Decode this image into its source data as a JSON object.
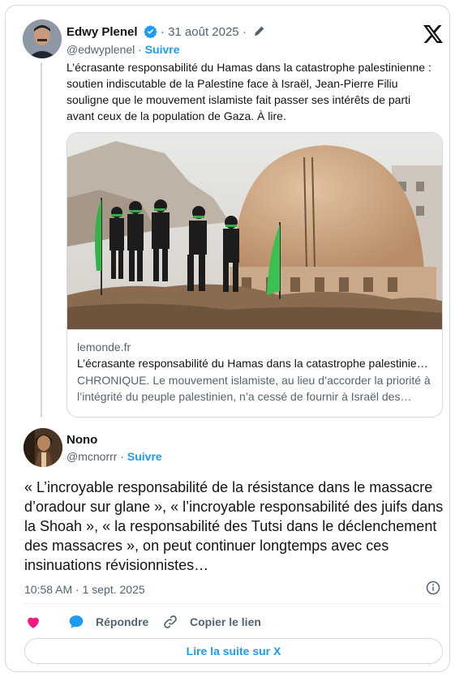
{
  "quoted": {
    "author_name": "Edwy Plenel",
    "date": "31 août 2025",
    "separator": "·",
    "handle": "@edwyplenel",
    "follow": "Suivre",
    "text": "L’écrasante responsabilité du Hamas dans la catastrophe palestinienne : soutien indiscutable de la Palestine face à Israël, Jean-Pierre Filiu souligne que le mouvement islamiste fait passer ses intérêts de parti avant ceux de la population de Gaza. À lire.",
    "link_card": {
      "domain": "lemonde.fr",
      "title": "L’écrasante responsabilité du Hamas dans la catastrophe palestinienne",
      "description": "CHRONIQUE. Le mouvement islamiste, au lieu d’accorder la priorité à l’intégrité du peuple palestinien, n’a cessé de fournir à Israël des prétextes"
    }
  },
  "tweet": {
    "author_name": "Nono",
    "handle": "@mcnorrr",
    "separator": "·",
    "follow": "Suivre",
    "text": "« L’incroyable responsabilité de la résistance dans le massacre d’oradour sur glane », « l’incroyable responsabilité des juifs dans la Shoah », « la responsabilité des Tutsi dans le déclenchement des massacres », on peut continuer longtemps avec ces insinuations révisionnistes…",
    "timestamp": "10:58 AM · 1 sept. 2025"
  },
  "actions": {
    "like_label": "",
    "reply_label": "Répondre",
    "copy_label": "Copier le lien",
    "read_more": "Lire la suite sur X"
  },
  "icons": {
    "brand": "x-logo-icon",
    "verified": "verified-badge-icon",
    "edited": "pencil-icon",
    "info": "info-icon",
    "like": "heart-icon",
    "reply": "speech-bubble-icon",
    "copy": "link-icon"
  },
  "colors": {
    "accent": "#1d9bf0",
    "like": "#f91880",
    "muted": "#536471",
    "border": "#cfd9de"
  }
}
